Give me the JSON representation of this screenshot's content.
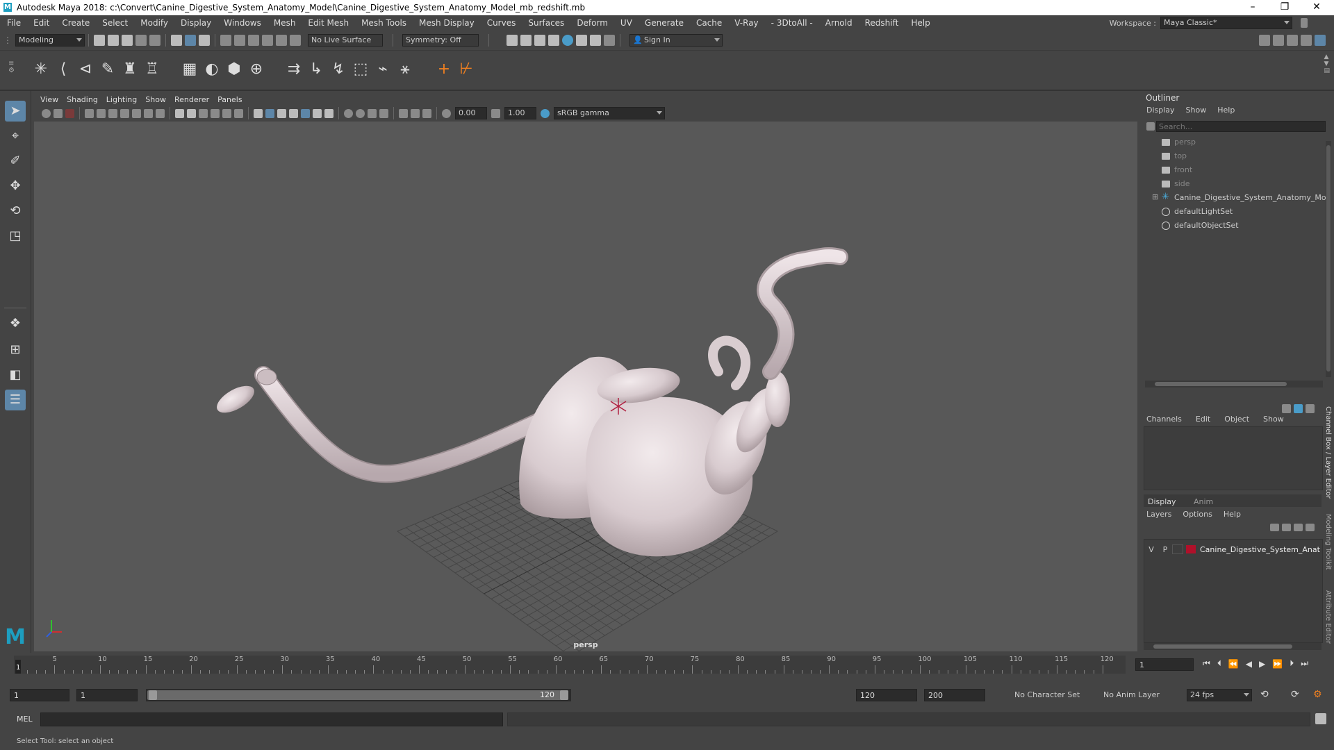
{
  "window": {
    "title": "Autodesk Maya 2018: c:\\Convert\\Canine_Digestive_System_Anatomy_Model\\Canine_Digestive_System_Anatomy_Model_mb_redshift.mb"
  },
  "menubar": {
    "items": [
      "File",
      "Edit",
      "Create",
      "Select",
      "Modify",
      "Display",
      "Windows",
      "Mesh",
      "Edit Mesh",
      "Mesh Tools",
      "Mesh Display",
      "Curves",
      "Surfaces",
      "Deform",
      "UV",
      "Generate",
      "Cache",
      "V-Ray",
      "- 3DtoAll -",
      "Arnold",
      "Redshift",
      "Help"
    ],
    "workspace_label": "Workspace :",
    "workspace_value": "Maya Classic*"
  },
  "statusline": {
    "mode": "Modeling",
    "live_surface": "No Live Surface",
    "symmetry": "Symmetry: Off",
    "sign_in": "Sign In"
  },
  "viewport": {
    "menu": [
      "View",
      "Shading",
      "Lighting",
      "Show",
      "Renderer",
      "Panels"
    ],
    "exposure": "0.00",
    "gamma": "1.00",
    "color_space": "sRGB gamma",
    "camera_label": "persp"
  },
  "outliner": {
    "title": "Outliner",
    "menu": [
      "Display",
      "Show",
      "Help"
    ],
    "search_placeholder": "Search...",
    "items": [
      "persp",
      "top",
      "front",
      "side",
      "Canine_Digestive_System_Anatomy_Moc",
      "defaultLightSet",
      "defaultObjectSet"
    ]
  },
  "channelbox": {
    "menu": [
      "Channels",
      "Edit",
      "Object",
      "Show"
    ],
    "side_tab": "Channel Box / Layer Editor"
  },
  "side_tabs": [
    "Modeling Toolkit",
    "Attribute Editor"
  ],
  "layers": {
    "tabs": [
      "Display",
      "Anim"
    ],
    "menu": [
      "Layers",
      "Options",
      "Help"
    ],
    "layer": {
      "v": "V",
      "p": "P",
      "name": "Canine_Digestive_System_Anat",
      "color": "#b0102a"
    }
  },
  "timeslider": {
    "ticks": [
      "5",
      "10",
      "15",
      "20",
      "25",
      "30",
      "35",
      "40",
      "45",
      "50",
      "55",
      "60",
      "65",
      "70",
      "75",
      "80",
      "85",
      "90",
      "95",
      "100",
      "105",
      "110",
      "115",
      "120"
    ],
    "current_marker": "1",
    "current_frame": "1"
  },
  "rangeslider": {
    "start": "1",
    "playback_start": "1",
    "range_start": "1",
    "range_end": "120",
    "playback_end": "120",
    "end": "200",
    "character_set": "No Character Set",
    "anim_layer": "No Anim Layer",
    "fps": "24 fps"
  },
  "cmdline": {
    "label": "MEL"
  },
  "helpline": {
    "text": "Select Tool: select an object"
  }
}
